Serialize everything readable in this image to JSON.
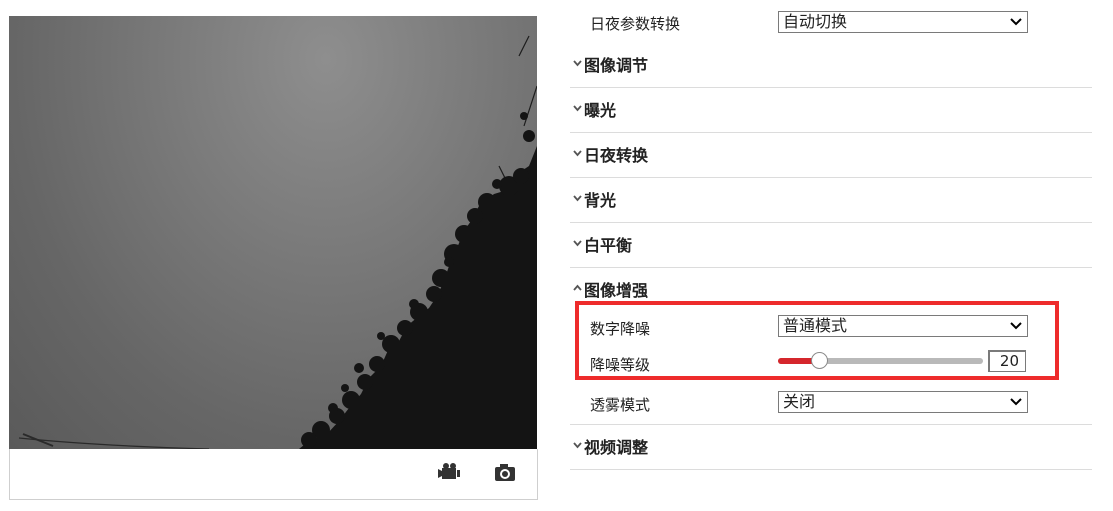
{
  "preview": {
    "record_icon": "video-camera-icon",
    "snapshot_icon": "camera-icon"
  },
  "settings": {
    "day_night_switch": {
      "label": "日夜参数转换",
      "value": "自动切换"
    },
    "sections": [
      {
        "title": "图像调节",
        "expanded": false
      },
      {
        "title": "曝光",
        "expanded": false
      },
      {
        "title": "日夜转换",
        "expanded": false
      },
      {
        "title": "背光",
        "expanded": false
      },
      {
        "title": "白平衡",
        "expanded": false
      },
      {
        "title": "图像增强",
        "expanded": true
      },
      {
        "title": "视频调整",
        "expanded": false
      }
    ],
    "image_enhance": {
      "digital_noise_reduction": {
        "label": "数字降噪",
        "value": "普通模式"
      },
      "noise_reduction_level": {
        "label": "降噪等级",
        "value": "20",
        "fraction": 0.2
      },
      "defog_mode": {
        "label": "透雾模式",
        "value": "关闭"
      }
    }
  },
  "colors": {
    "accent": "#d5262c",
    "highlight_border": "#ee2b2b"
  }
}
